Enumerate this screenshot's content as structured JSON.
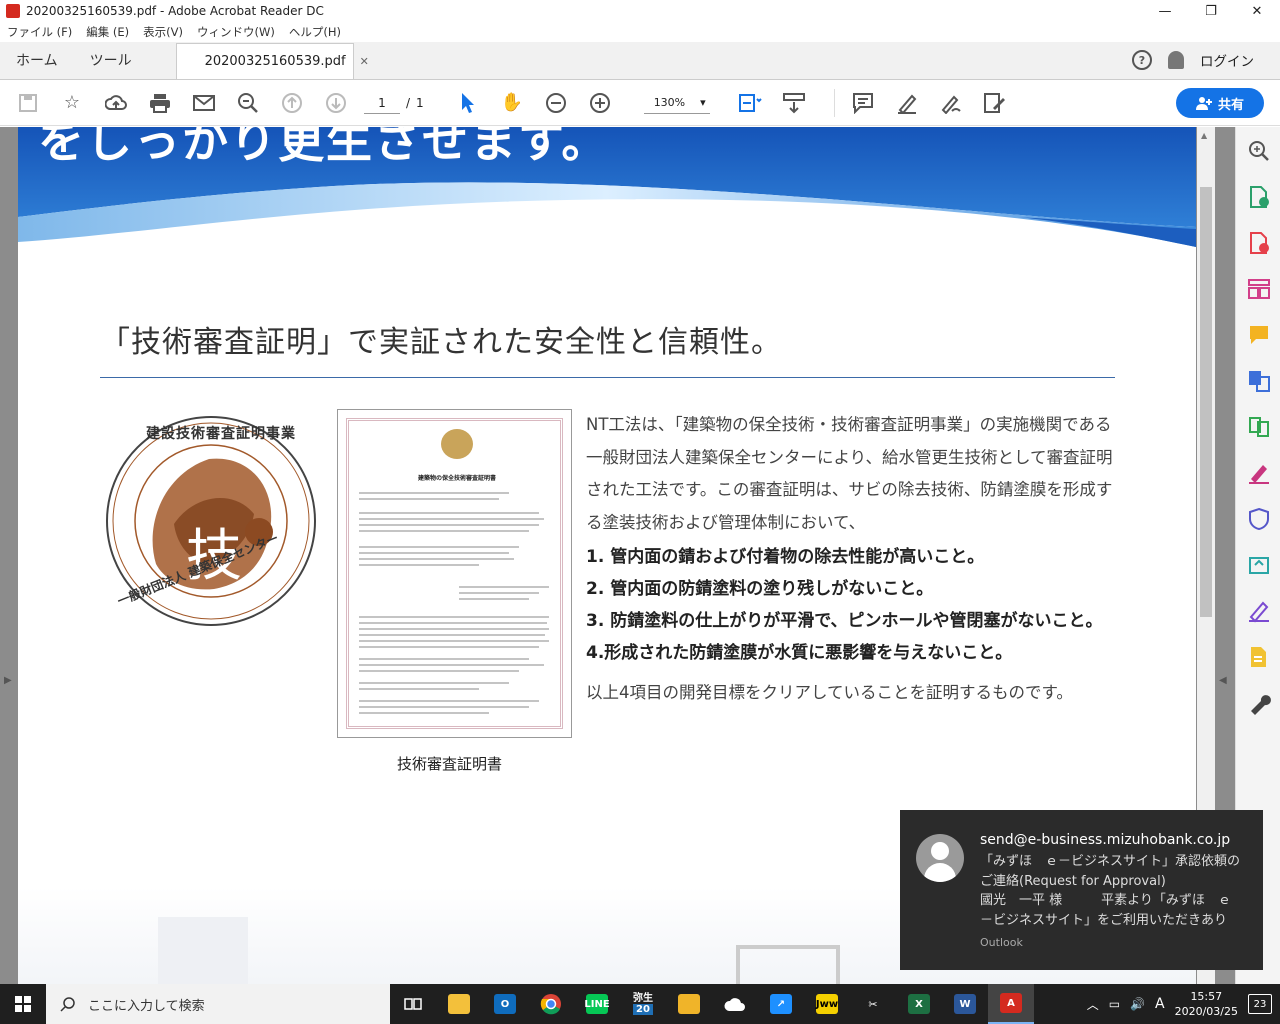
{
  "window": {
    "title": "20200325160539.pdf - Adobe Acrobat Reader DC",
    "minimize": "—",
    "maximize": "❐",
    "close": "✕"
  },
  "menu": [
    "ファイル (F)",
    "編集 (E)",
    "表示(V)",
    "ウィンドウ(W)",
    "ヘルプ(H)"
  ],
  "tabs": {
    "home": "ホーム",
    "tools": "ツール",
    "document": "20200325160539.pdf",
    "close": "✕"
  },
  "account": {
    "help": "?",
    "login": "ログイン"
  },
  "toolbar": {
    "page_current": "1",
    "page_sep": "/",
    "page_total": "1",
    "zoom": "130%",
    "share": "共有"
  },
  "document": {
    "banner_text": "をしっかり更生させます。",
    "heading": "「技術審査証明」で実証された安全性と信頼性。",
    "cert_caption": "技術審査証明書",
    "cert_title": "建築物の保全技術審査証明書",
    "seal_text_top": "建設技術審査証明事業",
    "seal_text_bottom": "一般財団法人 建築保全センター",
    "seal_center": "技",
    "body": "NT工法は、「建築物の保全技術・技術審査証明事業」の実施機関である一般財団法人建築保全センターにより、給水管更生技術として審査証明された工法です。この審査証明は、サビの除去技術、防錆塗膜を形成する塗装技術および管理体制において、",
    "points": [
      "1. 管内面の錆および付着物の除去性能が高いこと。",
      "2. 管内面の防錆塗料の塗り残しがないこと。",
      "3. 防錆塗料の仕上がりが平滑で、ピンホールや管閉塞がないこと。",
      "4.形成された防錆塗膜が水質に悪影響を与えないこと。"
    ],
    "conclusion": "以上4項目の開発目標をクリアしていることを証明するものです。"
  },
  "notification": {
    "sender": "send@e-business.mizuhobank.co.jp",
    "message": "「みずほ　ｅ－ビジネスサイト」承認依頼のご連絡(Request for Approval)\n國光　一平 様　　　平素より「みずほ　ｅ－ビジネスサイト」をご利用いただきあり",
    "source": "Outlook"
  },
  "taskbar": {
    "search_placeholder": "ここに入力して検索",
    "time": "15:57",
    "date": "2020/03/25",
    "ime": "A",
    "notification_count": "23",
    "yayoi_label": "弥生",
    "yayoi_version": "20",
    "jww_label": "Jww"
  },
  "colors": {
    "accent": "#1473e6",
    "banner_blue": "#1a5fc4",
    "seal_brown": "#a2592a",
    "toast_bg": "#2b2b2b",
    "taskbar_bg": "#1f1f1f"
  }
}
